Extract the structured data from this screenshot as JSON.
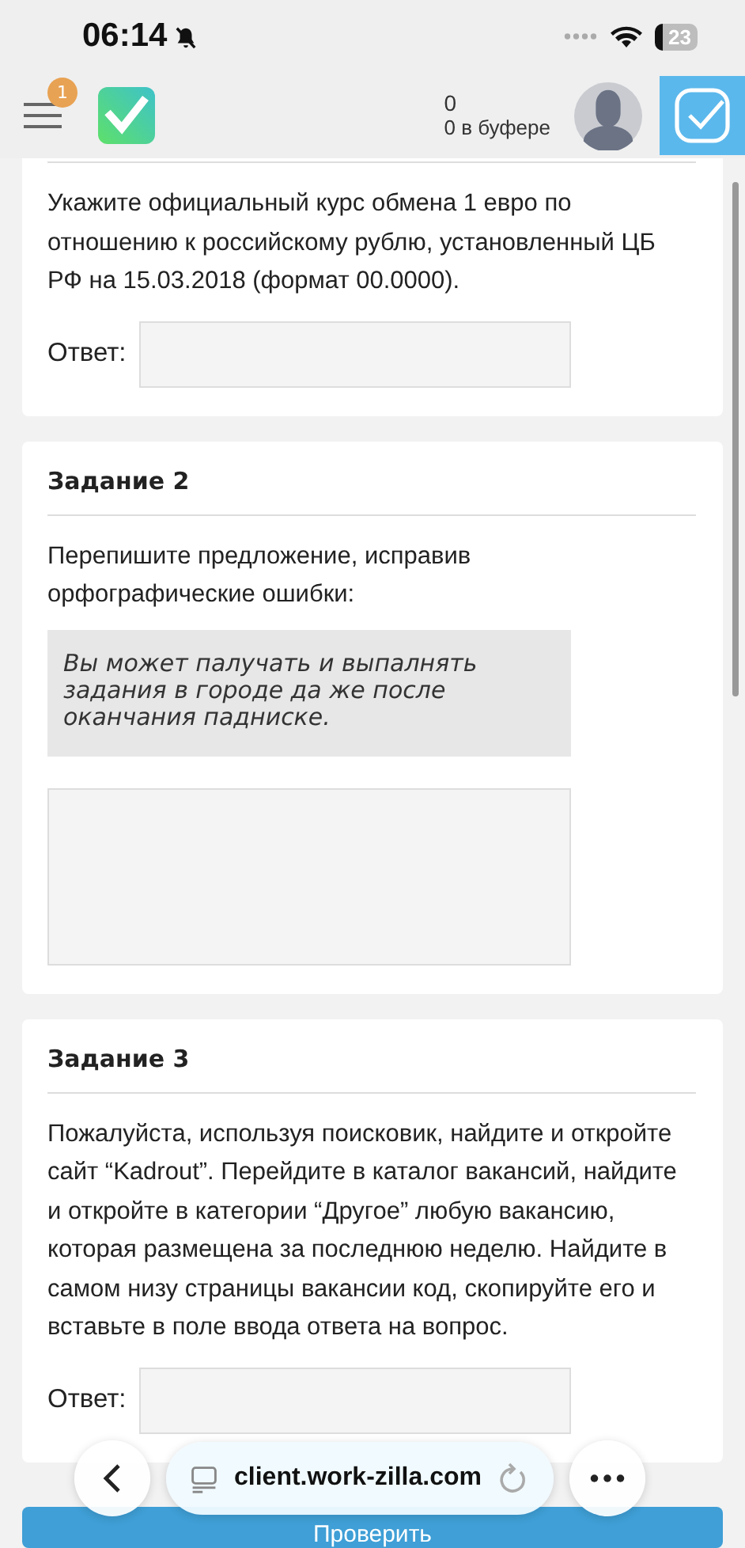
{
  "status_bar": {
    "time": "06:14",
    "battery": "23"
  },
  "header": {
    "notification_count": "1",
    "balance": "0",
    "buffer": "0 в буфере"
  },
  "tasks": [
    {
      "question": "Укажите официальный курс обмена 1 евро по отношению к российскому рублю, установленный ЦБ РФ на 15.03.2018 (формат 00.0000).",
      "answer": {
        "kind": "line",
        "label": "Ответ:"
      }
    },
    {
      "title": "Задание 2",
      "question": "Перепишите предложение, исправив орфографические ошибки:",
      "quote": "Вы может палучать и выпалнять задания в городе да же после оканчания падниске.",
      "answer": {
        "kind": "area"
      }
    },
    {
      "title": "Задание 3",
      "question": "Пожалуйста, используя поисковик, найдите и откройте сайт “Kadrout”. Перейдите в каталог вакансий, найдите и откройте в категории “Другое” любую вакансию, которая размещена за последнюю неделю. Найдите в самом низу страницы вакансии код, скопируйте его и вставьте в поле ввода ответа на вопрос.",
      "answer": {
        "kind": "line",
        "label": "Ответ:"
      }
    }
  ],
  "submit_button": "Проверить",
  "browser_bar": {
    "url": "client.work-zilla.com"
  }
}
